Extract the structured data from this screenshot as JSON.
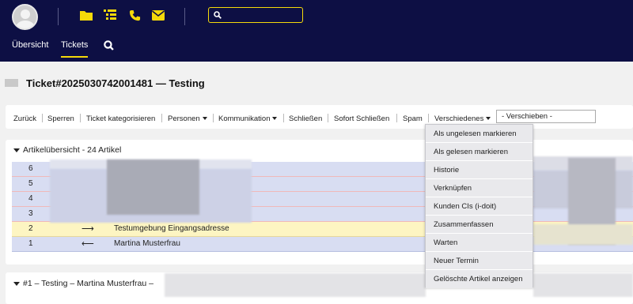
{
  "nav": {
    "items": [
      {
        "label": "Übersicht",
        "active": false
      },
      {
        "label": "Tickets",
        "active": true
      }
    ]
  },
  "colors": {
    "header_bg": "#0d0f44",
    "accent": "#f5d90a",
    "row_blue": "#d8ddf2",
    "row_yellow": "#fdf5c2"
  },
  "ticket": {
    "title": "Ticket#2025030742001481 — Testing"
  },
  "actions": [
    {
      "label": "Zurück",
      "has_caret": false
    },
    {
      "label": "Sperren",
      "has_caret": false
    },
    {
      "label": "Ticket kategorisieren",
      "has_caret": false
    },
    {
      "label": "Personen",
      "has_caret": true
    },
    {
      "label": "Kommunikation",
      "has_caret": true
    },
    {
      "label": "Schließen",
      "has_caret": false
    },
    {
      "label": "Sofort Schließen",
      "has_caret": false
    },
    {
      "label": "Spam",
      "has_caret": false
    },
    {
      "label": "Verschiedenes",
      "has_caret": true
    }
  ],
  "move_select": {
    "value": "- Verschieben -"
  },
  "article_overview": {
    "title": "Artikelübersicht - 24 Artikel",
    "rows": [
      {
        "num": "6",
        "dir": "",
        "subject": ""
      },
      {
        "num": "5",
        "dir": "",
        "subject": ""
      },
      {
        "num": "4",
        "dir": "",
        "subject": ""
      },
      {
        "num": "3",
        "dir": "",
        "subject": ""
      },
      {
        "num": "2",
        "dir": "⟶",
        "subject": "Testumgebung Eingangsadresse"
      },
      {
        "num": "1",
        "dir": "⟵",
        "subject": "Martina Musterfrau"
      }
    ]
  },
  "article_detail": {
    "title": "#1 – Testing – Martina Musterfrau –"
  },
  "dropdown": {
    "items": [
      "Als ungelesen markieren",
      "Als gelesen markieren",
      "Historie",
      "Verknüpfen",
      "Kunden CIs (i-doit)",
      "Zusammenfassen",
      "Warten",
      "Neuer Termin",
      "Gelöschte Artikel anzeigen"
    ]
  },
  "icons": {
    "header": [
      "avatar",
      "folder-icon",
      "list-icon",
      "phone-icon",
      "envelope-icon",
      "search-icon"
    ]
  }
}
